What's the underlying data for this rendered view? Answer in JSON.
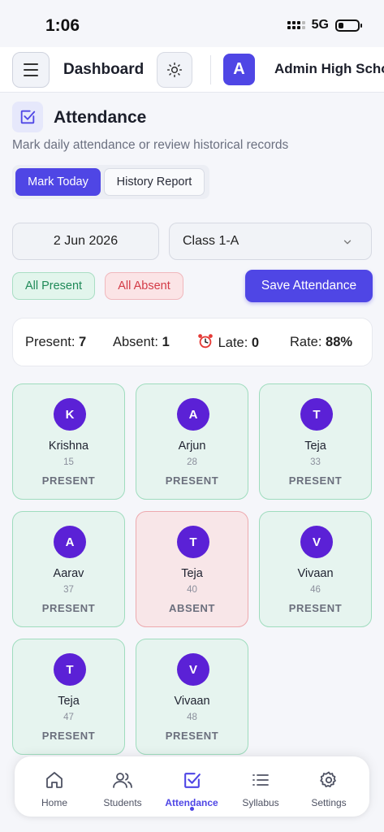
{
  "status_bar": {
    "time": "1:06",
    "network": "5G"
  },
  "header": {
    "title": "Dashboard",
    "school_initial": "A",
    "school_name": "Admin High School"
  },
  "page": {
    "title": "Attendance",
    "subtitle": "Mark daily attendance or review historical records"
  },
  "tabs": {
    "mark_today": "Mark Today",
    "history_report": "History Report"
  },
  "filters": {
    "date": "2 Jun 2026",
    "class": "Class 1-A"
  },
  "actions": {
    "all_present": "All Present",
    "all_absent": "All Absent",
    "save": "Save Attendance"
  },
  "summary": {
    "present_label": "Present:",
    "present_value": "7",
    "absent_label": "Absent:",
    "absent_value": "1",
    "late_label": "Late:",
    "late_value": "0",
    "rate_label": "Rate:",
    "rate_value": "88%"
  },
  "students": [
    {
      "initial": "K",
      "name": "Krishna",
      "roll": "15",
      "status": "PRESENT"
    },
    {
      "initial": "A",
      "name": "Arjun",
      "roll": "28",
      "status": "PRESENT"
    },
    {
      "initial": "T",
      "name": "Teja",
      "roll": "33",
      "status": "PRESENT"
    },
    {
      "initial": "A",
      "name": "Aarav",
      "roll": "37",
      "status": "PRESENT"
    },
    {
      "initial": "T",
      "name": "Teja",
      "roll": "40",
      "status": "ABSENT"
    },
    {
      "initial": "V",
      "name": "Vivaan",
      "roll": "46",
      "status": "PRESENT"
    },
    {
      "initial": "T",
      "name": "Teja",
      "roll": "47",
      "status": "PRESENT"
    },
    {
      "initial": "V",
      "name": "Vivaan",
      "roll": "48",
      "status": "PRESENT"
    }
  ],
  "nav": {
    "home": "Home",
    "students": "Students",
    "attendance": "Attendance",
    "syllabus": "Syllabus",
    "settings": "Settings"
  },
  "colors": {
    "accent": "#4f46e5",
    "avatar": "#5b21d6",
    "present_bg": "#e6f4ef",
    "absent_bg": "#f8e6e8"
  }
}
